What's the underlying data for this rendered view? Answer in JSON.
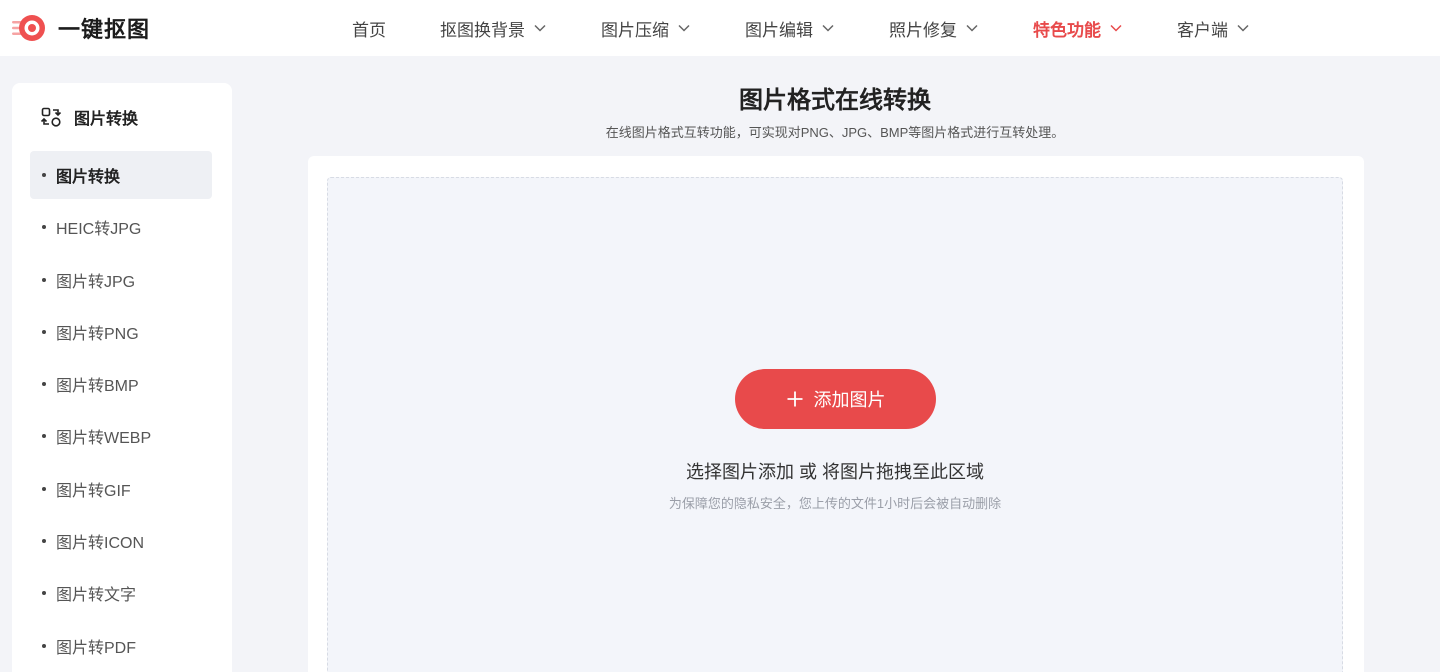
{
  "header": {
    "logo_text": "一键抠图",
    "nav": [
      {
        "label": "首页",
        "has_dropdown": false,
        "active": false
      },
      {
        "label": "抠图换背景",
        "has_dropdown": true,
        "active": false
      },
      {
        "label": "图片压缩",
        "has_dropdown": true,
        "active": false
      },
      {
        "label": "图片编辑",
        "has_dropdown": true,
        "active": false
      },
      {
        "label": "照片修复",
        "has_dropdown": true,
        "active": false
      },
      {
        "label": "特色功能",
        "has_dropdown": true,
        "active": true
      },
      {
        "label": "客户端",
        "has_dropdown": true,
        "active": false
      }
    ]
  },
  "sidebar": {
    "title": "图片转换",
    "items": [
      {
        "label": "图片转换",
        "active": true
      },
      {
        "label": "HEIC转JPG",
        "active": false
      },
      {
        "label": "图片转JPG",
        "active": false
      },
      {
        "label": "图片转PNG",
        "active": false
      },
      {
        "label": "图片转BMP",
        "active": false
      },
      {
        "label": "图片转WEBP",
        "active": false
      },
      {
        "label": "图片转GIF",
        "active": false
      },
      {
        "label": "图片转ICON",
        "active": false
      },
      {
        "label": "图片转文字",
        "active": false
      },
      {
        "label": "图片转PDF",
        "active": false
      }
    ]
  },
  "main": {
    "title": "图片格式在线转换",
    "subtitle": "在线图片格式互转功能，可实现对PNG、JPG、BMP等图片格式进行互转处理。",
    "add_button_label": "添加图片",
    "drop_hint": "选择图片添加 或 将图片拖拽至此区域",
    "privacy_note": "为保障您的隐私安全，您上传的文件1小时后会被自动删除"
  },
  "colors": {
    "accent": "#e84a4b",
    "page_bg": "#f3f4f8",
    "dropzone_bg": "#f3f5fa"
  }
}
